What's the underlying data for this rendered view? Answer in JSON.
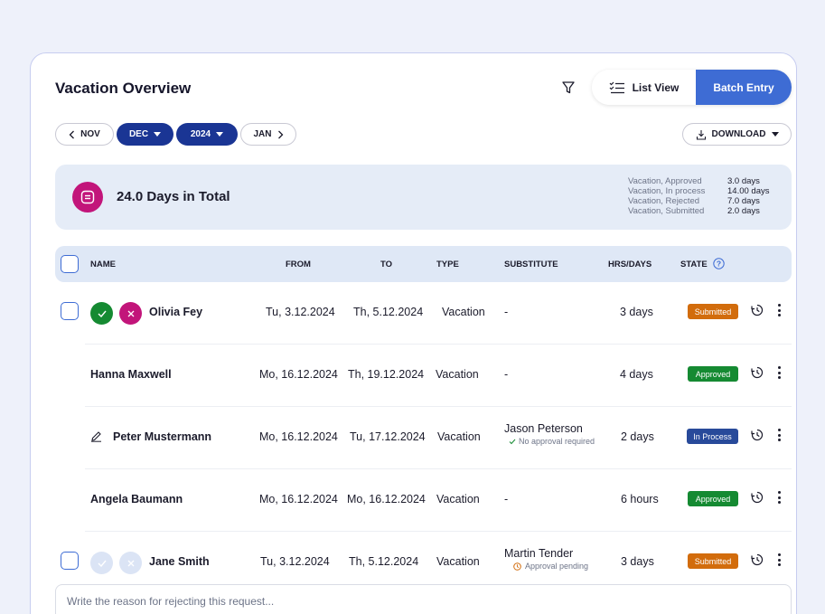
{
  "header": {
    "title": "Vacation Overview",
    "list_view_label": "List View",
    "batch_entry_label": "Batch Entry"
  },
  "date_nav": {
    "prev_month": "NOV",
    "month": "DEC",
    "year": "2024",
    "next_month": "JAN",
    "download_label": "DOWNLOAD"
  },
  "summary": {
    "total_label": "24.0 Days in Total",
    "items": [
      {
        "label": "Vacation, Approved",
        "value": "3.0 days"
      },
      {
        "label": "Vacation, In process",
        "value": "14.00 days"
      },
      {
        "label": "Vacation, Rejected",
        "value": "7.0 days"
      },
      {
        "label": "Vacation, Submitted",
        "value": "2.0 days"
      }
    ]
  },
  "table": {
    "columns": {
      "name": "NAME",
      "from": "FROM",
      "to": "TO",
      "type": "TYPE",
      "substitute": "SUBSTITUTE",
      "hrs_days": "HRS/DAYS",
      "state": "STATE"
    },
    "rows": [
      {
        "name": "Olivia Fey",
        "from": "Tu, 3.12.2024",
        "to": "Th, 5.12.2024",
        "type": "Vacation",
        "substitute": "-",
        "substitute_note": "",
        "amount": "3 days",
        "state": "Submitted"
      },
      {
        "name": "Hanna Maxwell",
        "from": "Mo, 16.12.2024",
        "to": "Th, 19.12.2024",
        "type": "Vacation",
        "substitute": "-",
        "substitute_note": "",
        "amount": "4 days",
        "state": "Approved"
      },
      {
        "name": "Peter Mustermann",
        "from": "Mo, 16.12.2024",
        "to": "Tu, 17.12.2024",
        "type": "Vacation",
        "substitute": "Jason Peterson",
        "substitute_note": "No approval required",
        "amount": "2 days",
        "state": "In Process"
      },
      {
        "name": "Angela Baumann",
        "from": "Mo, 16.12.2024",
        "to": "Mo, 16.12.2024",
        "type": "Vacation",
        "substitute": "-",
        "substitute_note": "",
        "amount": "6 hours",
        "state": "Approved"
      },
      {
        "name": "Jane Smith",
        "from": "Tu, 3.12.2024",
        "to": "Th, 5.12.2024",
        "type": "Vacation",
        "substitute": "Martin Tender",
        "substitute_note": "Approval pending",
        "amount": "3 days",
        "state": "Submitted"
      }
    ]
  },
  "reject_input": {
    "placeholder": "Write the reason for rejecting this request..."
  },
  "colors": {
    "accent": "#3e6cd4",
    "nav_pill": "#1a3594",
    "summary_icon": "#c2157a",
    "approve": "#158a32",
    "reject": "#c2157a",
    "submitted": "#d26c0c",
    "approved": "#158a32",
    "in_process": "#284a9a"
  }
}
